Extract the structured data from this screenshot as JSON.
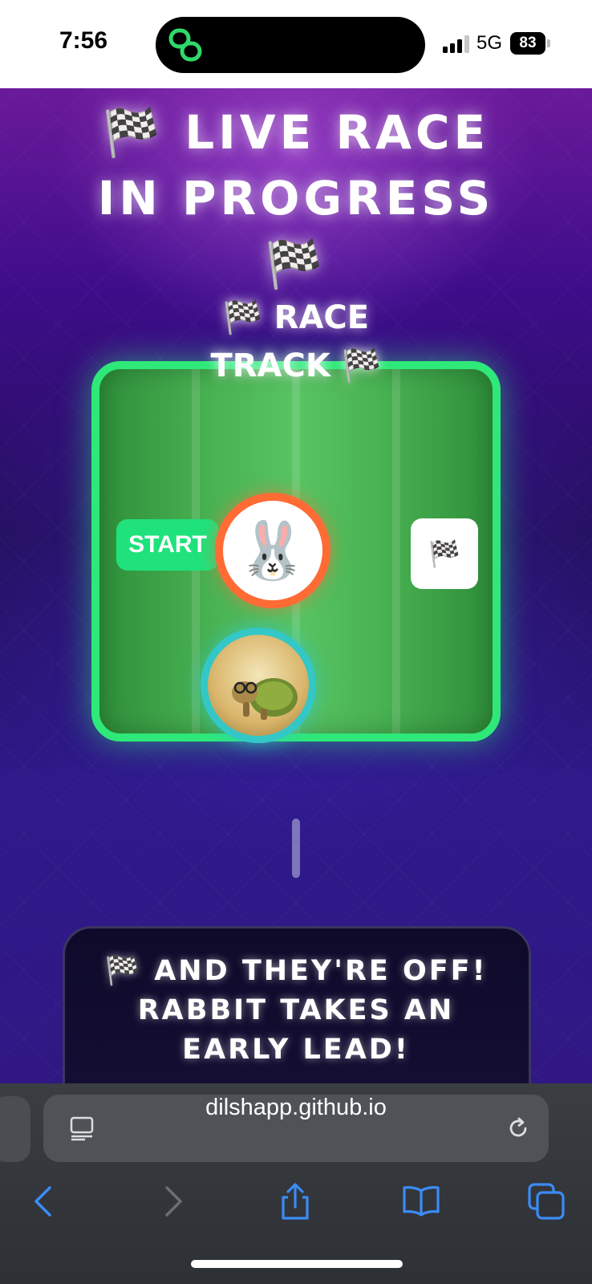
{
  "status_bar": {
    "time": "7:56",
    "network": "5G",
    "battery": "83"
  },
  "page": {
    "title": "🏁 LIVE RACE IN PROGRESS 🏁",
    "track_title": "🏁 RACE TRACK 🏁",
    "start_label": "START",
    "finish_flag": "🏁",
    "rabbit": "🐰",
    "commentary": "🏁 AND THEY'RE OFF! RABBIT TAKES AN EARLY LEAD!"
  },
  "browser": {
    "url": "dilshapp.github.io"
  },
  "colors": {
    "track_border": "#2ee879",
    "start_label": "#1fe27c",
    "rabbit_ring": "#ff6b35",
    "turtle_ring": "#34c7c7",
    "toolbar_icon": "#3b8cf5"
  },
  "icons": [
    "link-icon",
    "signal-icon",
    "reader-icon",
    "reload-icon",
    "back-icon",
    "forward-icon",
    "share-icon",
    "bookmarks-icon",
    "tabs-icon"
  ]
}
